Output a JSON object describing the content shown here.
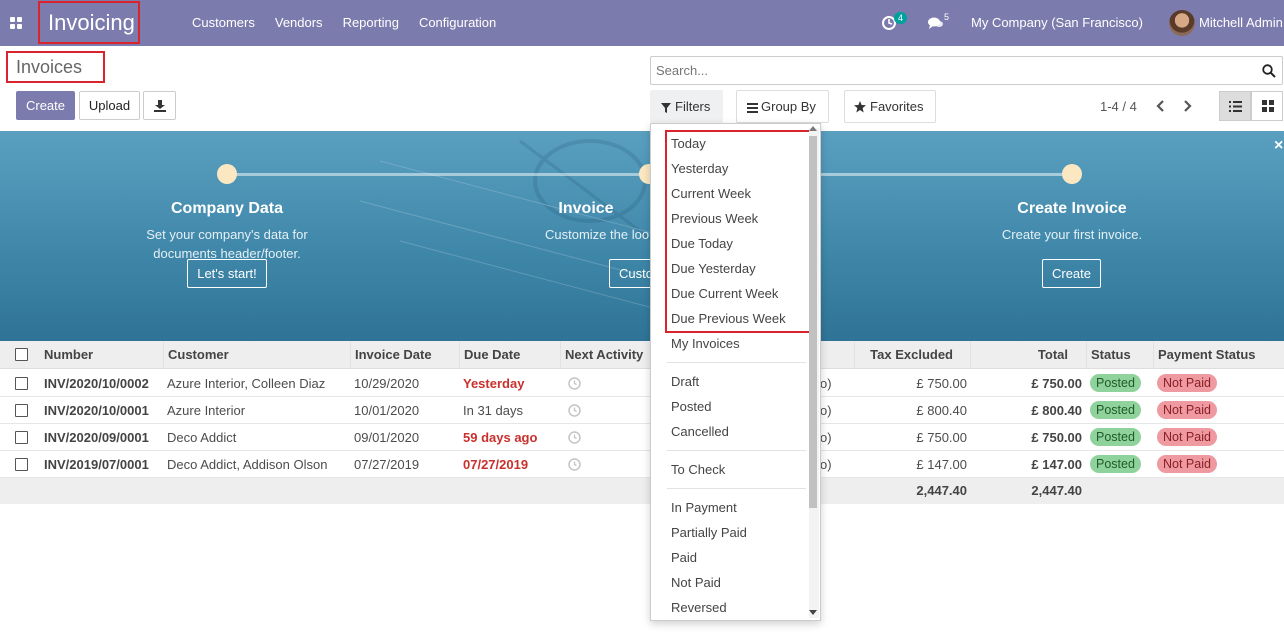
{
  "navbar": {
    "app_name": "Invoicing",
    "menu": [
      "Customers",
      "Vendors",
      "Reporting",
      "Configuration"
    ],
    "activity_count": "4",
    "message_count": "5",
    "company": "My Company (San Francisco)",
    "user": "Mitchell Admin"
  },
  "control_panel": {
    "breadcrumb": "Invoices",
    "create_label": "Create",
    "upload_label": "Upload",
    "search_placeholder": "Search...",
    "filters_label": "Filters",
    "group_by_label": "Group By",
    "favorites_label": "Favorites",
    "pager": "1-4 / 4"
  },
  "banner": {
    "steps": [
      {
        "title": "Company Data",
        "desc_line1": "Set your company's data for",
        "desc_line2": "documents header/footer.",
        "button": "Let's start!"
      },
      {
        "title": "Invoice",
        "desc_line1": "Customize the loo",
        "button": "Custo"
      },
      {
        "title": "Create Invoice",
        "desc_line1": "Create your first invoice.",
        "button": "Create"
      }
    ],
    "close": "×"
  },
  "table": {
    "headers": [
      "Number",
      "Customer",
      "Invoice Date",
      "Due Date",
      "Next Activity",
      "Tax Excluded",
      "Total",
      "Status",
      "Payment Status"
    ],
    "rows": [
      {
        "number": "INV/2020/10/0002",
        "customer": "Azure Interior, Colleen Diaz",
        "invoice_date": "10/29/2020",
        "due_date": "Yesterday",
        "due_overdue": true,
        "tail": "o)",
        "tax_excluded": "£ 750.00",
        "total": "£ 750.00",
        "status": "Posted",
        "payment_status": "Not Paid"
      },
      {
        "number": "INV/2020/10/0001",
        "customer": "Azure Interior",
        "invoice_date": "10/01/2020",
        "due_date": "In 31 days",
        "due_overdue": false,
        "tail": "o)",
        "tax_excluded": "£ 800.40",
        "total": "£ 800.40",
        "status": "Posted",
        "payment_status": "Not Paid"
      },
      {
        "number": "INV/2020/09/0001",
        "customer": "Deco Addict",
        "invoice_date": "09/01/2020",
        "due_date": "59 days ago",
        "due_overdue": true,
        "tail": "o)",
        "tax_excluded": "£ 750.00",
        "total": "£ 750.00",
        "status": "Posted",
        "payment_status": "Not Paid"
      },
      {
        "number": "INV/2019/07/0001",
        "customer": "Deco Addict, Addison Olson",
        "invoice_date": "07/27/2019",
        "due_date": "07/27/2019",
        "due_overdue": true,
        "tail": "o)",
        "tax_excluded": "£ 147.00",
        "total": "£ 147.00",
        "status": "Posted",
        "payment_status": "Not Paid"
      }
    ],
    "sum_tax_excluded": "2,447.40",
    "sum_total": "2,447.40"
  },
  "filters_dropdown": {
    "items": [
      "Today",
      "Yesterday",
      "Current Week",
      "Previous Week",
      "Due Today",
      "Due Yesterday",
      "Due Current Week",
      "Due Previous Week",
      "My Invoices",
      "Draft",
      "Posted",
      "Cancelled",
      "To Check",
      "In Payment",
      "Partially Paid",
      "Paid",
      "Not Paid",
      "Reversed"
    ]
  },
  "colors": {
    "navbar": "#7c7bad",
    "highlight": "#d9232d",
    "overdue": "#c9302c",
    "posted": "#8fd29b",
    "not_paid": "#ee9aa0"
  }
}
